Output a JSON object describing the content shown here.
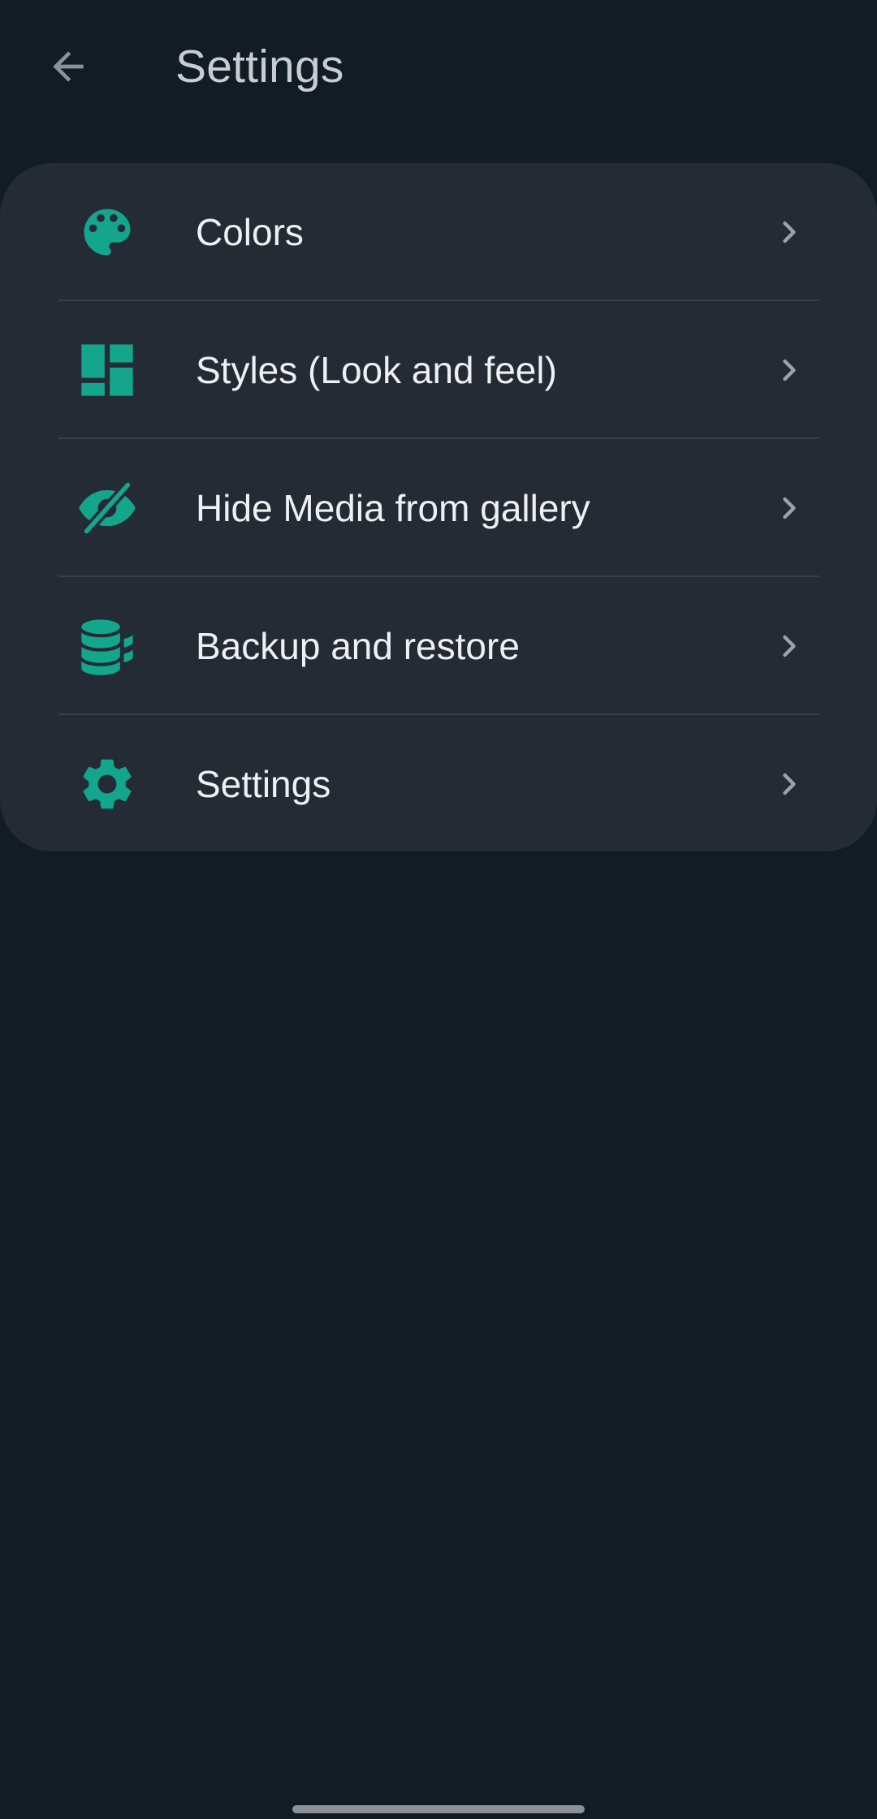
{
  "header": {
    "title": "Settings",
    "back_icon": "arrow-back-icon"
  },
  "menu": {
    "items": [
      {
        "label": "Colors",
        "icon": "palette-icon"
      },
      {
        "label": "Styles (Look and feel)",
        "icon": "dashboard-layout-icon"
      },
      {
        "label": "Hide Media from gallery",
        "icon": "eye-off-icon"
      },
      {
        "label": "Backup and restore",
        "icon": "database-icon"
      },
      {
        "label": "Settings",
        "icon": "gear-icon"
      }
    ],
    "chevron_icon": "chevron-right-icon"
  },
  "colors": {
    "background": "#111c24",
    "card": "#242b35",
    "accent": "#14a58d",
    "text_primary": "#eef0f2",
    "text_title": "#c9cdd1",
    "chevron": "#9aa3ab"
  }
}
